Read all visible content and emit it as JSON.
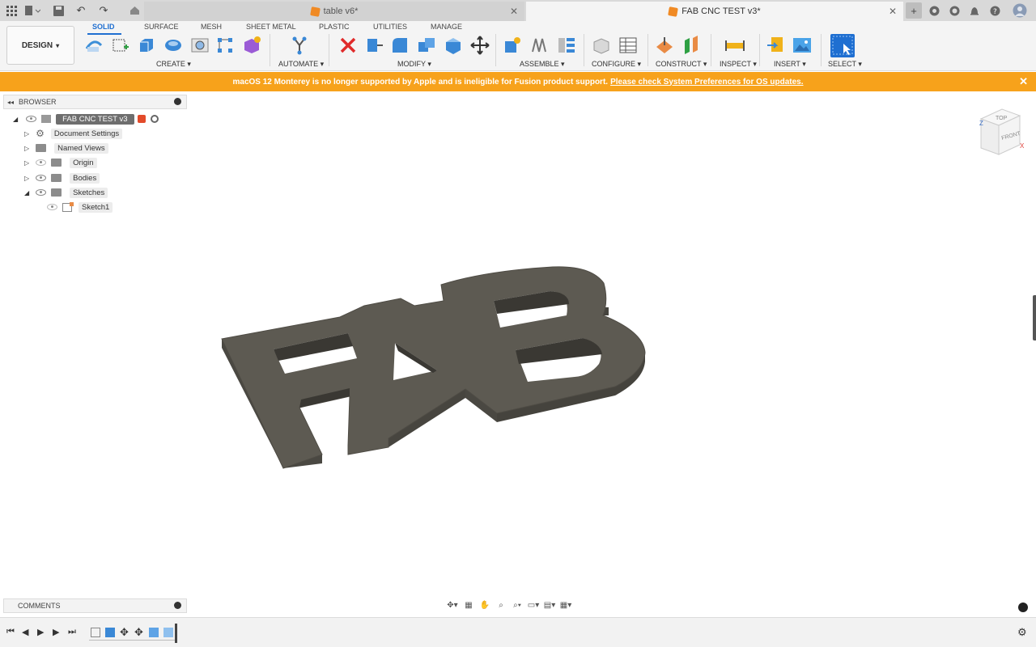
{
  "tabbar": {
    "tabs": [
      {
        "label": "table v6*",
        "active": false
      },
      {
        "label": "FAB CNC TEST v3*",
        "active": true
      }
    ]
  },
  "ribbon": {
    "workspace": "DESIGN",
    "tabs": [
      "SOLID",
      "SURFACE",
      "MESH",
      "SHEET METAL",
      "PLASTIC",
      "UTILITIES",
      "MANAGE"
    ],
    "active_tab": "SOLID",
    "groups": [
      "CREATE",
      "AUTOMATE",
      "MODIFY",
      "ASSEMBLE",
      "CONFIGURE",
      "CONSTRUCT",
      "INSPECT",
      "INSERT",
      "SELECT"
    ]
  },
  "banner": {
    "message": "macOS 12 Monterey is no longer supported by Apple and is ineligible for Fusion product support.",
    "link": "Please check System Preferences for OS updates."
  },
  "browser": {
    "title": "BROWSER",
    "root": "FAB CNC TEST v3",
    "items": [
      {
        "label": "Document Settings"
      },
      {
        "label": "Named Views"
      },
      {
        "label": "Origin"
      },
      {
        "label": "Bodies"
      },
      {
        "label": "Sketches"
      },
      {
        "label": "Sketch1"
      }
    ]
  },
  "comments": {
    "title": "COMMENTS"
  },
  "viewcube": {
    "top": "TOP",
    "front": "FRONT",
    "axis_z": "Z",
    "axis_x": "X"
  },
  "colors": {
    "accent": "#1f6fd1",
    "banner": "#f7a21b",
    "model": "#5d5a52"
  }
}
